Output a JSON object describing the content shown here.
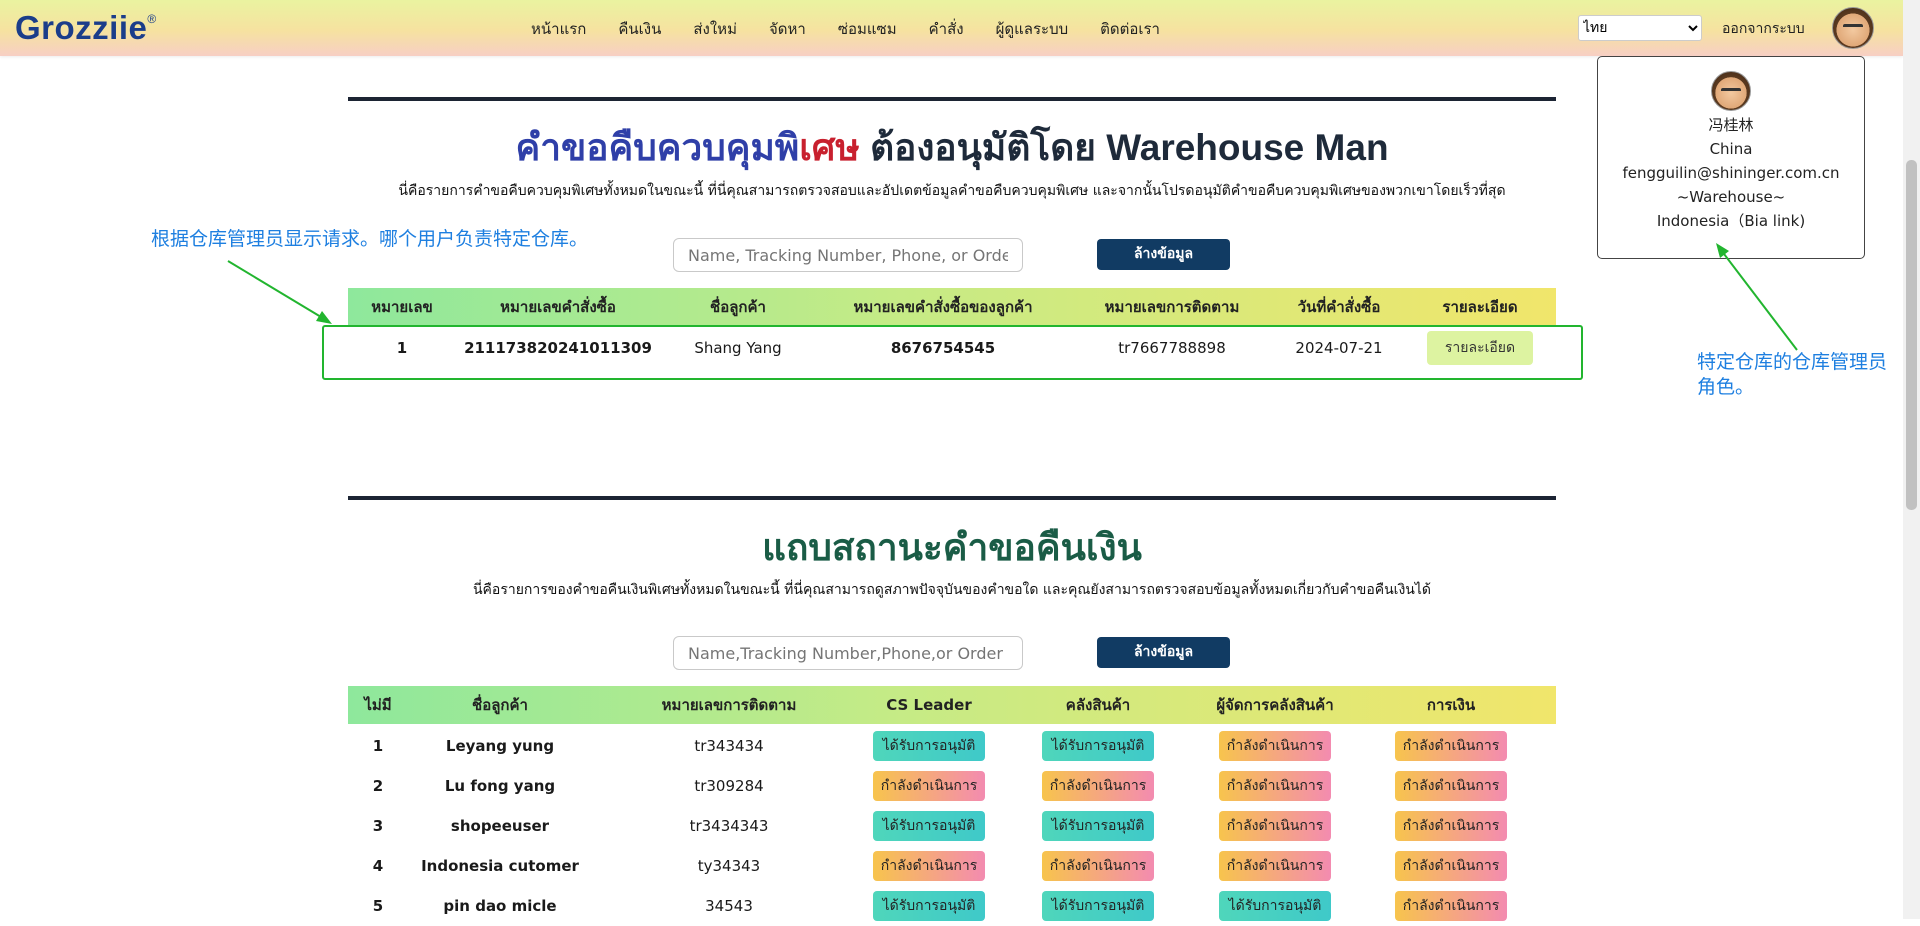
{
  "brand": {
    "name": "Grozziie",
    "mark": "®"
  },
  "nav": [
    "หน้าแรก",
    "คืนเงิน",
    "ส่งใหม่",
    "จัดหา",
    "ซ่อมแซม",
    "คำสั่ง",
    "ผู้ดูแลระบบ",
    "ติดต่อเรา"
  ],
  "language": {
    "selected": "ไทย"
  },
  "logout_label": "ออกจากระบบ",
  "user_popup": {
    "name": "冯桂林",
    "country": "China",
    "email": "fengguilin@shininger.com.cn",
    "role": "~Warehouse~",
    "warehouse": "Indonesia（Bia link)"
  },
  "section1": {
    "title_part1": "คำขอคืบควบคุมพิ",
    "title_part2": "เศษ",
    "title_part3": " ต้องอนุมัติโดย Warehouse Man",
    "subtitle": "นี่คือรายการคำขอคืบควบคุมพิเศษทั้งหมดในขณะนี้ ที่นี่คุณสามารถตรวจสอบและอัปเดตข้อมูลคำขอคืบควบคุมพิเศษ และจากนั้นโปรดอนุมัติคำขอคืบควบคุมพิเศษของพวกเขาโดยเร็วที่สุด",
    "search_placeholder": "Name, Tracking Number, Phone, or Order Numbe",
    "clear_label": "ล้างข้อมูล",
    "columns": [
      "หมายเลข",
      "หมายเลขคำสั่งซื้อ",
      "ชื่อลูกค้า",
      "หมายเลขคำสั่งซื้อของลูกค้า",
      "หมายเลขการติดตาม",
      "วันที่คำสั่งซื้อ",
      "รายละเอียด"
    ],
    "rows": [
      {
        "no": "1",
        "order": "211173820241011309",
        "customer": "Shang Yang",
        "customer_order": "8676754545",
        "tracking": "tr7667788898",
        "date": "2024-07-21",
        "detail": "รายละเอียด"
      }
    ]
  },
  "annotations": {
    "left": "根据仓库管理员显示请求。哪个用户负责特定仓库。",
    "right_line1": "特定仓库的仓库管理员",
    "right_line2": "角色。"
  },
  "section2": {
    "title": "แถบสถานะคำขอคืนเงิน",
    "subtitle": "นี่คือรายการของคำขอคืนเงินพิเศษทั้งหมดในขณะนี้ ที่นี่คุณสามารถดูสภาพปัจจุบันของคำขอใด และคุณยังสามารถตรวจสอบข้อมูลทั้งหมดเกี่ยวกับคำขอคืนเงินได้",
    "search_placeholder": "Name,Tracking Number,Phone,or Order Number",
    "clear_label": "ล้างข้อมูล",
    "columns": [
      "ไม่มี",
      "ชื่อลูกค้า",
      "หมายเลขการติดตาม",
      "CS Leader",
      "คลังสินค้า",
      "ผู้จัดการคลังสินค้า",
      "การเงิน"
    ],
    "status_labels": {
      "approved": "ได้รับการอนุมัติ",
      "in_progress": "กำลังดำเนินการ"
    },
    "rows": [
      {
        "no": "1",
        "customer": "Leyang yung",
        "tracking": "tr343434",
        "cs": "ได้รับการอนุมัติ",
        "warehouse": "ได้รับการอนุมัติ",
        "manager": "กำลังดำเนินการ",
        "finance": "กำลังดำเนินการ"
      },
      {
        "no": "2",
        "customer": "Lu fong yang",
        "tracking": "tr309284",
        "cs": "กำลังดำเนินการ",
        "warehouse": "กำลังดำเนินการ",
        "manager": "กำลังดำเนินการ",
        "finance": "กำลังดำเนินการ"
      },
      {
        "no": "3",
        "customer": "shopeeuser",
        "tracking": "tr3434343",
        "cs": "ได้รับการอนุมัติ",
        "warehouse": "ได้รับการอนุมัติ",
        "manager": "กำลังดำเนินการ",
        "finance": "กำลังดำเนินการ"
      },
      {
        "no": "4",
        "customer": "Indonesia cutomer",
        "tracking": "ty34343",
        "cs": "กำลังดำเนินการ",
        "warehouse": "กำลังดำเนินการ",
        "manager": "กำลังดำเนินการ",
        "finance": "กำลังดำเนินการ"
      },
      {
        "no": "5",
        "customer": "pin dao micle",
        "tracking": "34543",
        "cs": "ได้รับการอนุมัติ",
        "warehouse": "ได้รับการอนุมัติ",
        "manager": "ได้รับการอนุมัติ",
        "finance": "กำลังดำเนินการ"
      }
    ]
  },
  "colors": {
    "annotation": "#1e7fe0",
    "highlight": "#22b52f",
    "button": "#113b63"
  },
  "icons": [
    "avatar-icon",
    "arrow-icon"
  ]
}
